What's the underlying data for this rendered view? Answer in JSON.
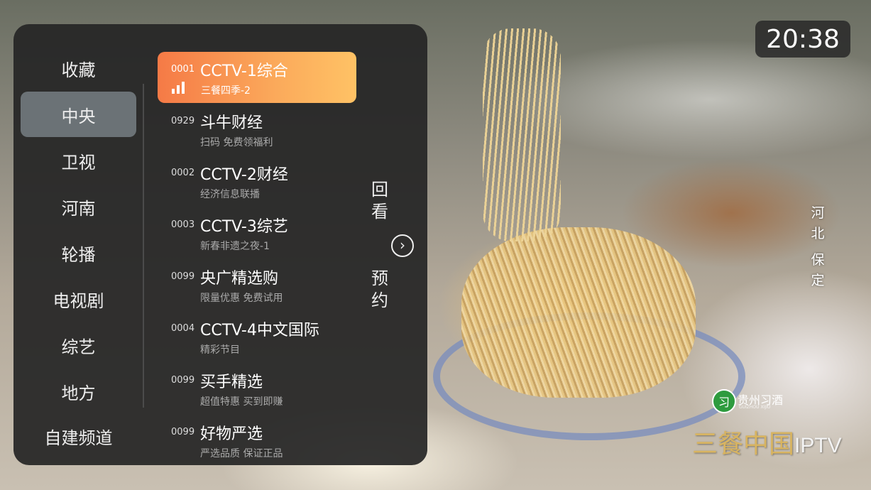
{
  "clock": "20:38",
  "region_overlay": "河北 保定",
  "watermark": {
    "brand": "贵州习酒",
    "brand_sub": "GUIZHOU XIJIU",
    "show": "三餐中国",
    "tv": "IPTV"
  },
  "categories": [
    {
      "label": "收藏"
    },
    {
      "label": "中央",
      "active": true
    },
    {
      "label": "卫视"
    },
    {
      "label": "河南"
    },
    {
      "label": "轮播"
    },
    {
      "label": "电视剧"
    },
    {
      "label": "综艺"
    },
    {
      "label": "地方"
    },
    {
      "label": "自建频道"
    }
  ],
  "channels": [
    {
      "number": "0001",
      "name": "CCTV-1综合",
      "program": "三餐四季-2",
      "active": true
    },
    {
      "number": "0929",
      "name": "斗牛财经",
      "program": "扫码 免费领福利"
    },
    {
      "number": "0002",
      "name": "CCTV-2财经",
      "program": "经济信息联播"
    },
    {
      "number": "0003",
      "name": "CCTV-3综艺",
      "program": "新春非遗之夜-1"
    },
    {
      "number": "0099",
      "name": "央广精选购",
      "program": "限量优惠 免费试用"
    },
    {
      "number": "0004",
      "name": "CCTV-4中文国际",
      "program": "精彩节目"
    },
    {
      "number": "0099",
      "name": "买手精选",
      "program": "超值特惠 买到即赚"
    },
    {
      "number": "0099",
      "name": "好物严选",
      "program": "严选品质 保证正品"
    }
  ],
  "side_buttons": {
    "replay": "回看",
    "reserve": "预约",
    "arrow_icon": "chevron-right-circle-icon"
  },
  "colors": {
    "active_gradient_start": "#f57a46",
    "active_gradient_end": "#ffc265",
    "active_category_bg": "#6b7276"
  }
}
